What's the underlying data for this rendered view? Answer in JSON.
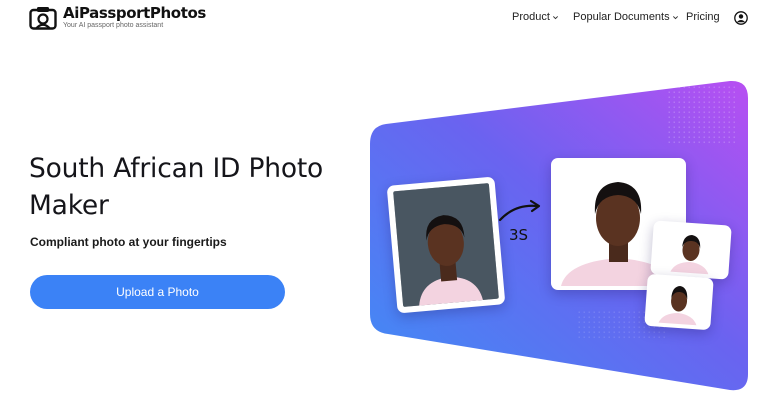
{
  "brand": {
    "name": "AiPassportPhotos",
    "tagline": "Your AI passport photo assistant"
  },
  "nav": {
    "product": "Product",
    "documents": "Popular Documents",
    "pricing": "Pricing",
    "product_icon": "chevron-down-icon",
    "documents_icon": "chevron-down-icon",
    "account_icon": "user-circle-icon"
  },
  "hero": {
    "title": "South African ID Photo Maker",
    "subtitle": "Compliant photo at your fingertips",
    "cta": "Upload a Photo"
  },
  "illustration": {
    "time_label": "3S",
    "gradient_colors": [
      "#3f8df5",
      "#6a63f0",
      "#b84ff2"
    ]
  },
  "colors": {
    "accent": "#3b82f6",
    "text": "#15151a"
  }
}
